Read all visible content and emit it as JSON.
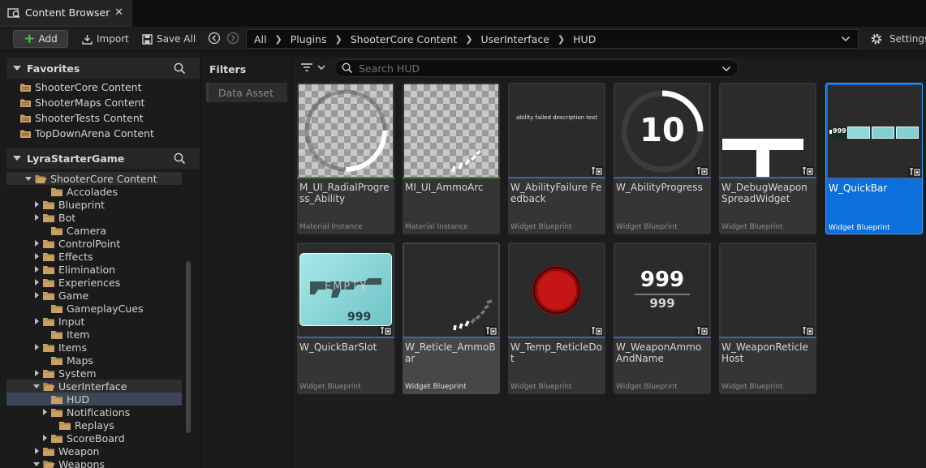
{
  "tab": {
    "title": "Content Browser",
    "close": "✕"
  },
  "toolbar": {
    "add_label": "Add",
    "import_label": "Import",
    "save_all_label": "Save All",
    "settings_label": "Settings"
  },
  "breadcrumb": [
    "All",
    "Plugins",
    "ShooterCore Content",
    "UserInterface",
    "HUD"
  ],
  "favorites": {
    "title": "Favorites",
    "items": [
      "ShooterCore Content",
      "ShooterMaps Content",
      "ShooterTests Content",
      "TopDownArena Content"
    ]
  },
  "project": {
    "title": "LyraStarterGame"
  },
  "tree": [
    {
      "label": "ShooterCore Content",
      "arrow": "d",
      "icon": "folder-open"
    },
    {
      "label": "Accolades",
      "arrow": "",
      "icon": "folder"
    },
    {
      "label": "Blueprint",
      "arrow": "r",
      "icon": "folder"
    },
    {
      "label": "Bot",
      "arrow": "r",
      "icon": "folder"
    },
    {
      "label": "Camera",
      "arrow": "",
      "icon": "folder"
    },
    {
      "label": "ControlPoint",
      "arrow": "r",
      "icon": "folder"
    },
    {
      "label": "Effects",
      "arrow": "r",
      "icon": "folder"
    },
    {
      "label": "Elimination",
      "arrow": "r",
      "icon": "folder"
    },
    {
      "label": "Experiences",
      "arrow": "r",
      "icon": "folder"
    },
    {
      "label": "Game",
      "arrow": "r",
      "icon": "folder"
    },
    {
      "label": "GameplayCues",
      "arrow": "",
      "icon": "folder"
    },
    {
      "label": "Input",
      "arrow": "r",
      "icon": "folder"
    },
    {
      "label": "Item",
      "arrow": "",
      "icon": "folder"
    },
    {
      "label": "Items",
      "arrow": "r",
      "icon": "folder"
    },
    {
      "label": "Maps",
      "arrow": "",
      "icon": "folder"
    },
    {
      "label": "System",
      "arrow": "r",
      "icon": "folder"
    },
    {
      "label": "UserInterface",
      "arrow": "d",
      "icon": "folder-open"
    },
    {
      "label": "HUD",
      "arrow": "",
      "icon": "folder"
    },
    {
      "label": "Notifications",
      "arrow": "r",
      "icon": "folder"
    },
    {
      "label": "Replays",
      "arrow": "",
      "icon": "folder"
    },
    {
      "label": "ScoreBoard",
      "arrow": "r",
      "icon": "folder"
    },
    {
      "label": "Weapon",
      "arrow": "r",
      "icon": "folder"
    },
    {
      "label": "Weapons",
      "arrow": "d",
      "icon": "folder-open"
    }
  ],
  "filters": {
    "title": "Filters",
    "chip": "Data Asset"
  },
  "search": {
    "placeholder": "Search HUD",
    "value": ""
  },
  "assets": [
    {
      "name": "M_UI_RadialProgress_Ability",
      "type": "Material Instance",
      "thumb": "radial"
    },
    {
      "name": "MI_UI_AmmoArc",
      "type": "Material Instance",
      "thumb": "ammoarc"
    },
    {
      "name": "W_AbilityFailure Feedback",
      "type": "Widget Blueprint",
      "thumb": "failure",
      "text": "ability failed description text"
    },
    {
      "name": "W_AbilityProgress",
      "type": "Widget Blueprint",
      "thumb": "progress",
      "text": "10"
    },
    {
      "name": "W_DebugWeapon SpreadWidget",
      "type": "Widget Blueprint",
      "thumb": "tshape"
    },
    {
      "name": "W_QuickBar",
      "type": "Widget Blueprint",
      "thumb": "quickbar",
      "text": "999"
    },
    {
      "name": "W_QuickBarSlot",
      "type": "Widget Blueprint",
      "thumb": "slot",
      "text": "999",
      "sub": "EMPTY"
    },
    {
      "name": "W_Reticle_AmmoBar",
      "type": "Widget Blueprint",
      "thumb": "reticlebar"
    },
    {
      "name": "W_Temp_ReticleDot",
      "type": "Widget Blueprint",
      "thumb": "dot"
    },
    {
      "name": "W_WeaponAmmo AndName",
      "type": "Widget Blueprint",
      "thumb": "ammo",
      "text": "999",
      "sub": "999"
    },
    {
      "name": "W_WeaponReticle Host",
      "type": "Widget Blueprint",
      "thumb": "host"
    }
  ],
  "selected_asset": "W_QuickBar",
  "hovered_asset": "W_Reticle_AmmoBar",
  "colors": {
    "selection": "#0b6fdc",
    "material_stripe": "#3e8a3e",
    "widget_stripe": "#3a66b2",
    "add_plus": "#39c742",
    "folder": "#c9a062"
  }
}
